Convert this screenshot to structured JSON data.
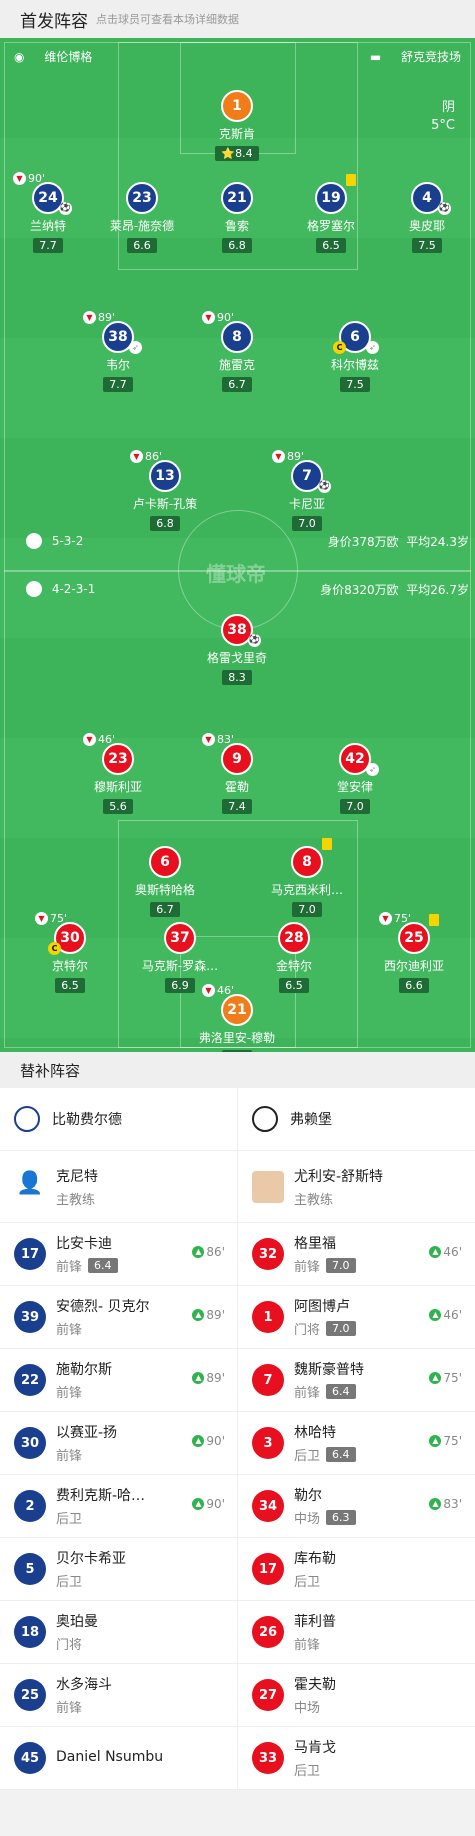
{
  "header": {
    "title": "首发阵容",
    "subtitle": "点击球员可查看本场详细数据"
  },
  "match": {
    "home_team": "比勒费尔德",
    "away_team": "弗赖堡",
    "venue_left": "维伦博格",
    "venue_right": "舒克竞技场",
    "weather": "阴",
    "temperature": "5°C",
    "watermark": "懂球帝"
  },
  "home_info": {
    "formation": "5-3-2",
    "value": "身价378万欧",
    "age": "平均24.3岁"
  },
  "away_info": {
    "formation": "4-2-3-1",
    "value": "身价8320万欧",
    "age": "平均26.7岁"
  },
  "home_players": [
    {
      "no": "1",
      "name": "克斯肯",
      "rating": "⭐8.4",
      "gk": true
    },
    {
      "no": "24",
      "name": "兰纳特",
      "rating": "7.7",
      "sub": "90'",
      "ball": true
    },
    {
      "no": "23",
      "name": "莱昂-施奈德",
      "rating": "6.6"
    },
    {
      "no": "21",
      "name": "鲁索",
      "rating": "6.8"
    },
    {
      "no": "19",
      "name": "格罗塞尔",
      "rating": "6.5",
      "yellow": true
    },
    {
      "no": "4",
      "name": "奥皮耶",
      "rating": "7.5",
      "ball": true
    },
    {
      "no": "38",
      "name": "韦尔",
      "rating": "7.7",
      "sub": "89'",
      "arrow": true
    },
    {
      "no": "8",
      "name": "施雷克",
      "rating": "6.7",
      "sub": "90'"
    },
    {
      "no": "6",
      "name": "科尔博兹",
      "rating": "7.5",
      "arrow": true,
      "captain": true
    },
    {
      "no": "13",
      "name": "卢卡斯-孔策",
      "rating": "6.8",
      "sub": "86'"
    },
    {
      "no": "7",
      "name": "卡尼亚",
      "rating": "7.0",
      "sub": "89'",
      "ball": true
    }
  ],
  "away_players": [
    {
      "no": "38",
      "name": "格雷戈里奇",
      "rating": "8.3",
      "ball": true
    },
    {
      "no": "23",
      "name": "穆斯利亚",
      "rating": "5.6",
      "sub": "46'"
    },
    {
      "no": "9",
      "name": "霍勒",
      "rating": "7.4",
      "sub": "83'"
    },
    {
      "no": "42",
      "name": "堂安律",
      "rating": "7.0",
      "arrow": true
    },
    {
      "no": "6",
      "name": "奥斯特哈格",
      "rating": "6.7"
    },
    {
      "no": "8",
      "name": "马克西米利…",
      "rating": "7.0",
      "yellow": true
    },
    {
      "no": "30",
      "name": "京特尔",
      "rating": "6.5",
      "sub": "75'",
      "captain": true
    },
    {
      "no": "37",
      "name": "马克斯-罗森…",
      "rating": "6.9"
    },
    {
      "no": "28",
      "name": "金特尔",
      "rating": "6.5"
    },
    {
      "no": "25",
      "name": "西尔迪利亚",
      "rating": "6.6",
      "sub": "75'",
      "yellow": true
    },
    {
      "no": "21",
      "name": "弗洛里安-穆勒",
      "rating": "6.1",
      "sub": "46'",
      "gk": true
    }
  ],
  "bench": {
    "title": "替补阵容",
    "home_coach": {
      "name": "克尼特",
      "role": "主教练"
    },
    "away_coach": {
      "name": "尤利安-舒斯特",
      "role": "主教练"
    },
    "home": [
      {
        "no": "17",
        "name": "比安卡迪",
        "pos": "前锋",
        "rating": "6.4",
        "min": "86'"
      },
      {
        "no": "39",
        "name": "安德烈- 贝克尔",
        "pos": "前锋",
        "min": "89'"
      },
      {
        "no": "22",
        "name": "施勒尔斯",
        "pos": "前锋",
        "min": "89'"
      },
      {
        "no": "30",
        "name": "以赛亚-扬",
        "pos": "前锋",
        "min": "90'"
      },
      {
        "no": "2",
        "name": "费利克斯-哈…",
        "pos": "后卫",
        "min": "90'"
      },
      {
        "no": "5",
        "name": "贝尔卡希亚",
        "pos": "后卫"
      },
      {
        "no": "18",
        "name": "奥珀曼",
        "pos": "门将"
      },
      {
        "no": "25",
        "name": "水多海斗",
        "pos": "前锋"
      },
      {
        "no": "45",
        "name": "Daniel Nsumbu",
        "pos": ""
      }
    ],
    "away": [
      {
        "no": "32",
        "name": "格里福",
        "pos": "前锋",
        "rating": "7.0",
        "min": "46'"
      },
      {
        "no": "1",
        "name": "阿图博卢",
        "pos": "门将",
        "rating": "7.0",
        "min": "46'"
      },
      {
        "no": "7",
        "name": "魏斯豪普特",
        "pos": "前锋",
        "rating": "6.4",
        "min": "75'"
      },
      {
        "no": "3",
        "name": "林哈特",
        "pos": "后卫",
        "rating": "6.4",
        "min": "75'"
      },
      {
        "no": "34",
        "name": "勒尔",
        "pos": "中场",
        "rating": "6.3",
        "min": "83'"
      },
      {
        "no": "17",
        "name": "库布勒",
        "pos": "后卫"
      },
      {
        "no": "26",
        "name": "菲利普",
        "pos": "前锋"
      },
      {
        "no": "27",
        "name": "霍夫勒",
        "pos": "中场"
      },
      {
        "no": "33",
        "name": "马肯戈",
        "pos": "后卫"
      }
    ]
  }
}
